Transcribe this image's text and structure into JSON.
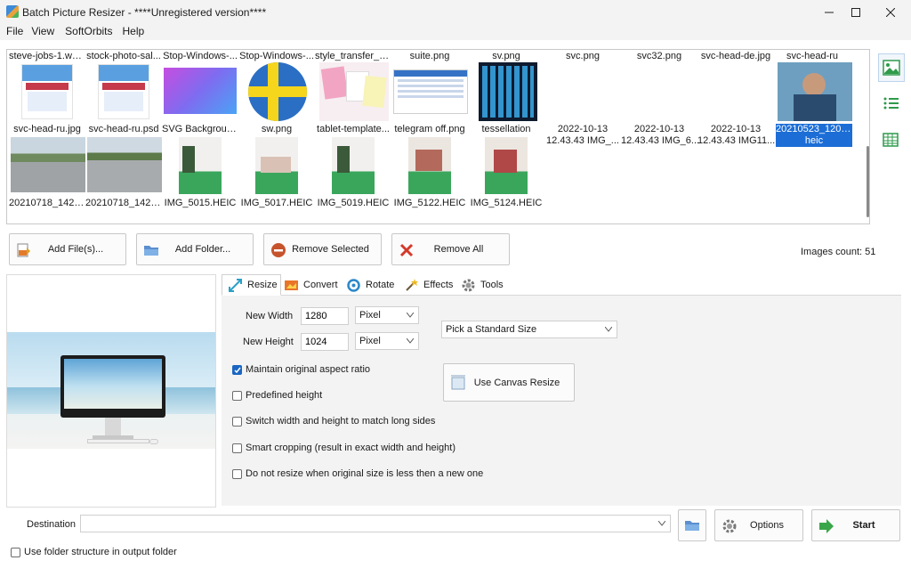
{
  "window": {
    "title": "Batch Picture Resizer - ****Unregistered version****"
  },
  "menu": [
    "File",
    "View",
    "SoftOrbits",
    "Help"
  ],
  "files": {
    "row1_names": [
      "steve-jobs-1.we...",
      "stock-photo-sal...",
      "Stop-Windows-...",
      "Stop-Windows-...",
      "style_transfer_tes...",
      "suite.png",
      "sv.png",
      "svc.png",
      "svc32.png",
      "svc-head-de.jpg",
      "svc-head-ru"
    ],
    "row2": [
      {
        "name": "svc-head-ru.jpg"
      },
      {
        "name": "svc-head-ru.psd"
      },
      {
        "name": "SVG Backgrounds"
      },
      {
        "name": "sw.png"
      },
      {
        "name": "tablet-template..."
      },
      {
        "name": "telegram off.png"
      },
      {
        "name": "tessellation"
      },
      {
        "name": "2022-10-13",
        "sub": "12.43.43 IMG_..."
      },
      {
        "name": "2022-10-13",
        "sub": "12.43.43 IMG_6..."
      },
      {
        "name": "2022-10-13",
        "sub": "12.43.43 IMG11..."
      },
      {
        "name": "20210523_120702.",
        "sub": "heic"
      }
    ],
    "row3": [
      "20210718_14213...",
      "20210718_14233...",
      "IMG_5015.HEIC",
      "IMG_5017.HEIC",
      "IMG_5019.HEIC",
      "IMG_5122.HEIC",
      "IMG_5124.HEIC"
    ]
  },
  "actions": {
    "add_files": "Add File(s)...",
    "add_folder": "Add Folder...",
    "remove_selected": "Remove Selected",
    "remove_all": "Remove All",
    "images_count": "Images count: 51"
  },
  "tabs": [
    "Resize",
    "Convert",
    "Rotate",
    "Effects",
    "Tools"
  ],
  "resize": {
    "new_width_label": "New Width",
    "new_width_value": "1280",
    "new_height_label": "New Height",
    "new_height_value": "1024",
    "unit_width": "Pixel",
    "unit_height": "Pixel",
    "standard_size": "Pick a Standard Size",
    "canvas_resize": "Use Canvas Resize",
    "opt_aspect": "Maintain original aspect ratio",
    "opt_predefined": "Predefined height",
    "opt_switch": "Switch width and height to match long sides",
    "opt_smart": "Smart cropping (result in exact width and height)",
    "opt_noresize": "Do not resize when original size is less then a new one"
  },
  "bottom": {
    "destination_label": "Destination",
    "destination_value": "",
    "options": "Options",
    "start": "Start",
    "folder_structure": "Use folder structure in output folder"
  },
  "colors": {
    "accent": "#1a66c2",
    "selection": "#1c6ed6",
    "titlebar": "#f3f3f3"
  }
}
